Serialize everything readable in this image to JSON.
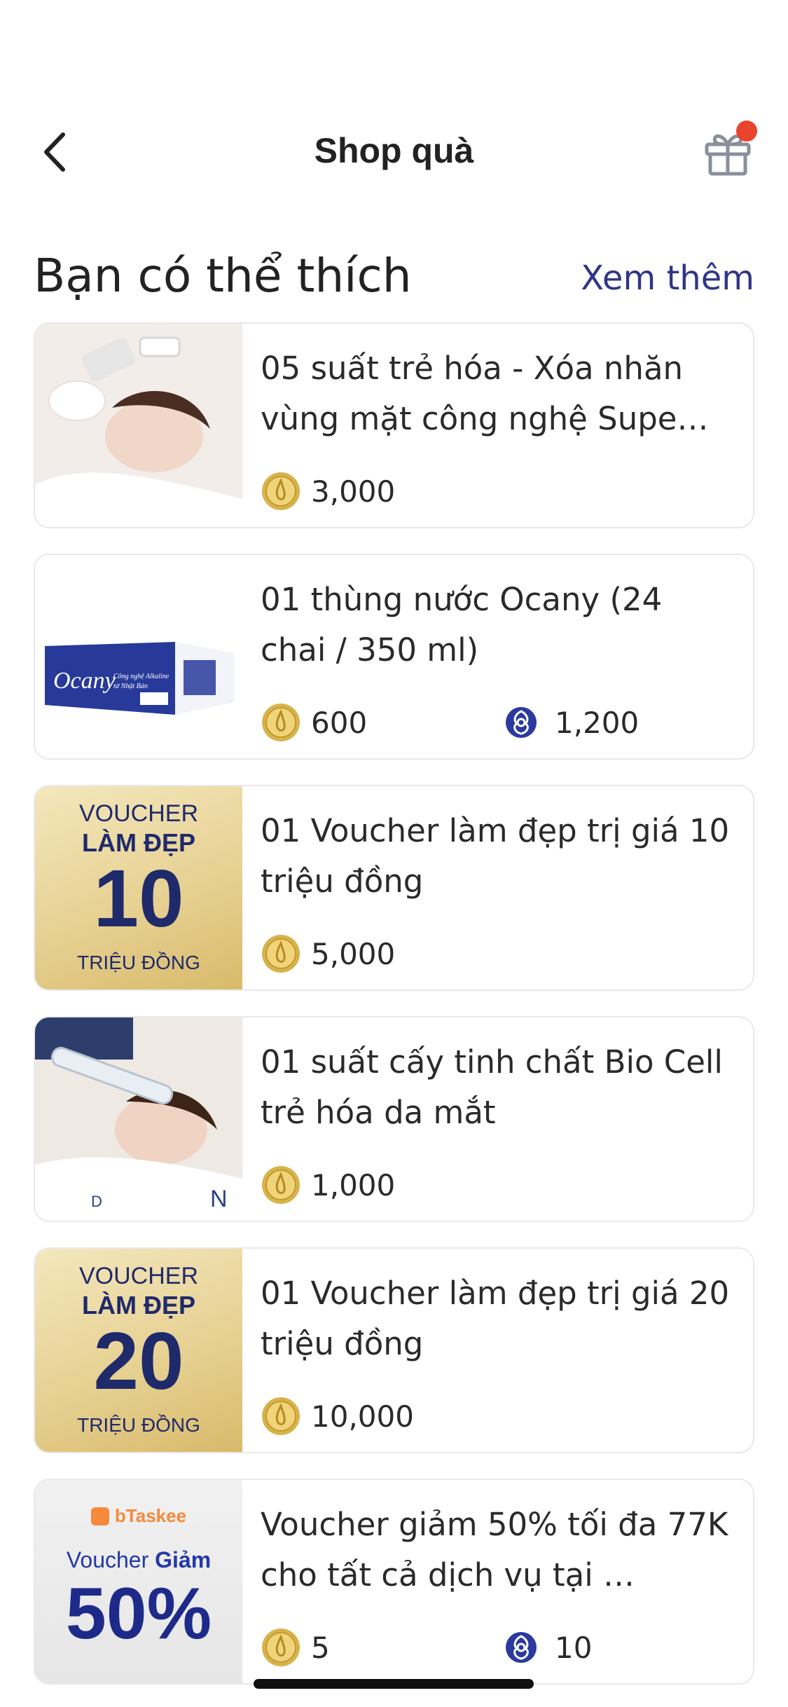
{
  "header": {
    "title": "Shop quà",
    "back_icon": "chevron-left-icon",
    "gift_icon": "gift-icon",
    "badge_color": "#e8452c"
  },
  "section": {
    "title": "Bạn có thể thích",
    "see_more": "Xem thêm",
    "accent": "#2f3687"
  },
  "items": [
    {
      "title": "05 suất trẻ hóa - Xóa nhăn vùng mặt công nghệ Supe…",
      "coin_price": "3,000",
      "rose_price": null
    },
    {
      "title": "01 thùng nước Ocany (24 chai / 350 ml)",
      "coin_price": "600",
      "rose_price": "1,200"
    },
    {
      "title": "01 Voucher làm đẹp trị giá 10 triệu đồng",
      "coin_price": "5,000",
      "rose_price": null,
      "voucher": {
        "top": "VOUCHER",
        "mid": "LÀM ĐẸP",
        "num": "10",
        "bottom": "TRIỆU ĐỒNG"
      }
    },
    {
      "title": "01 suất cấy tinh chất Bio Cell trẻ hóa da mắt",
      "coin_price": "1,000",
      "rose_price": null
    },
    {
      "title": "01 Voucher làm đẹp trị giá 20 triệu đồng",
      "coin_price": "10,000",
      "rose_price": null,
      "voucher": {
        "top": "VOUCHER",
        "mid": "LÀM ĐẸP",
        "num": "20",
        "bottom": "TRIỆU ĐỒNG"
      }
    },
    {
      "title": "Voucher giảm 50% tối đa 77K cho tất cả dịch vụ tại …",
      "coin_price": "5",
      "rose_price": "10",
      "btaskee": {
        "brand": "bTaskee",
        "line1": "Voucher",
        "line1b": "Giảm",
        "big": "50%"
      }
    }
  ],
  "product_box": {
    "brand": "Ocany",
    "sub1": "Công nghệ Alkaline",
    "sub2": "từ Nhật Bản"
  }
}
